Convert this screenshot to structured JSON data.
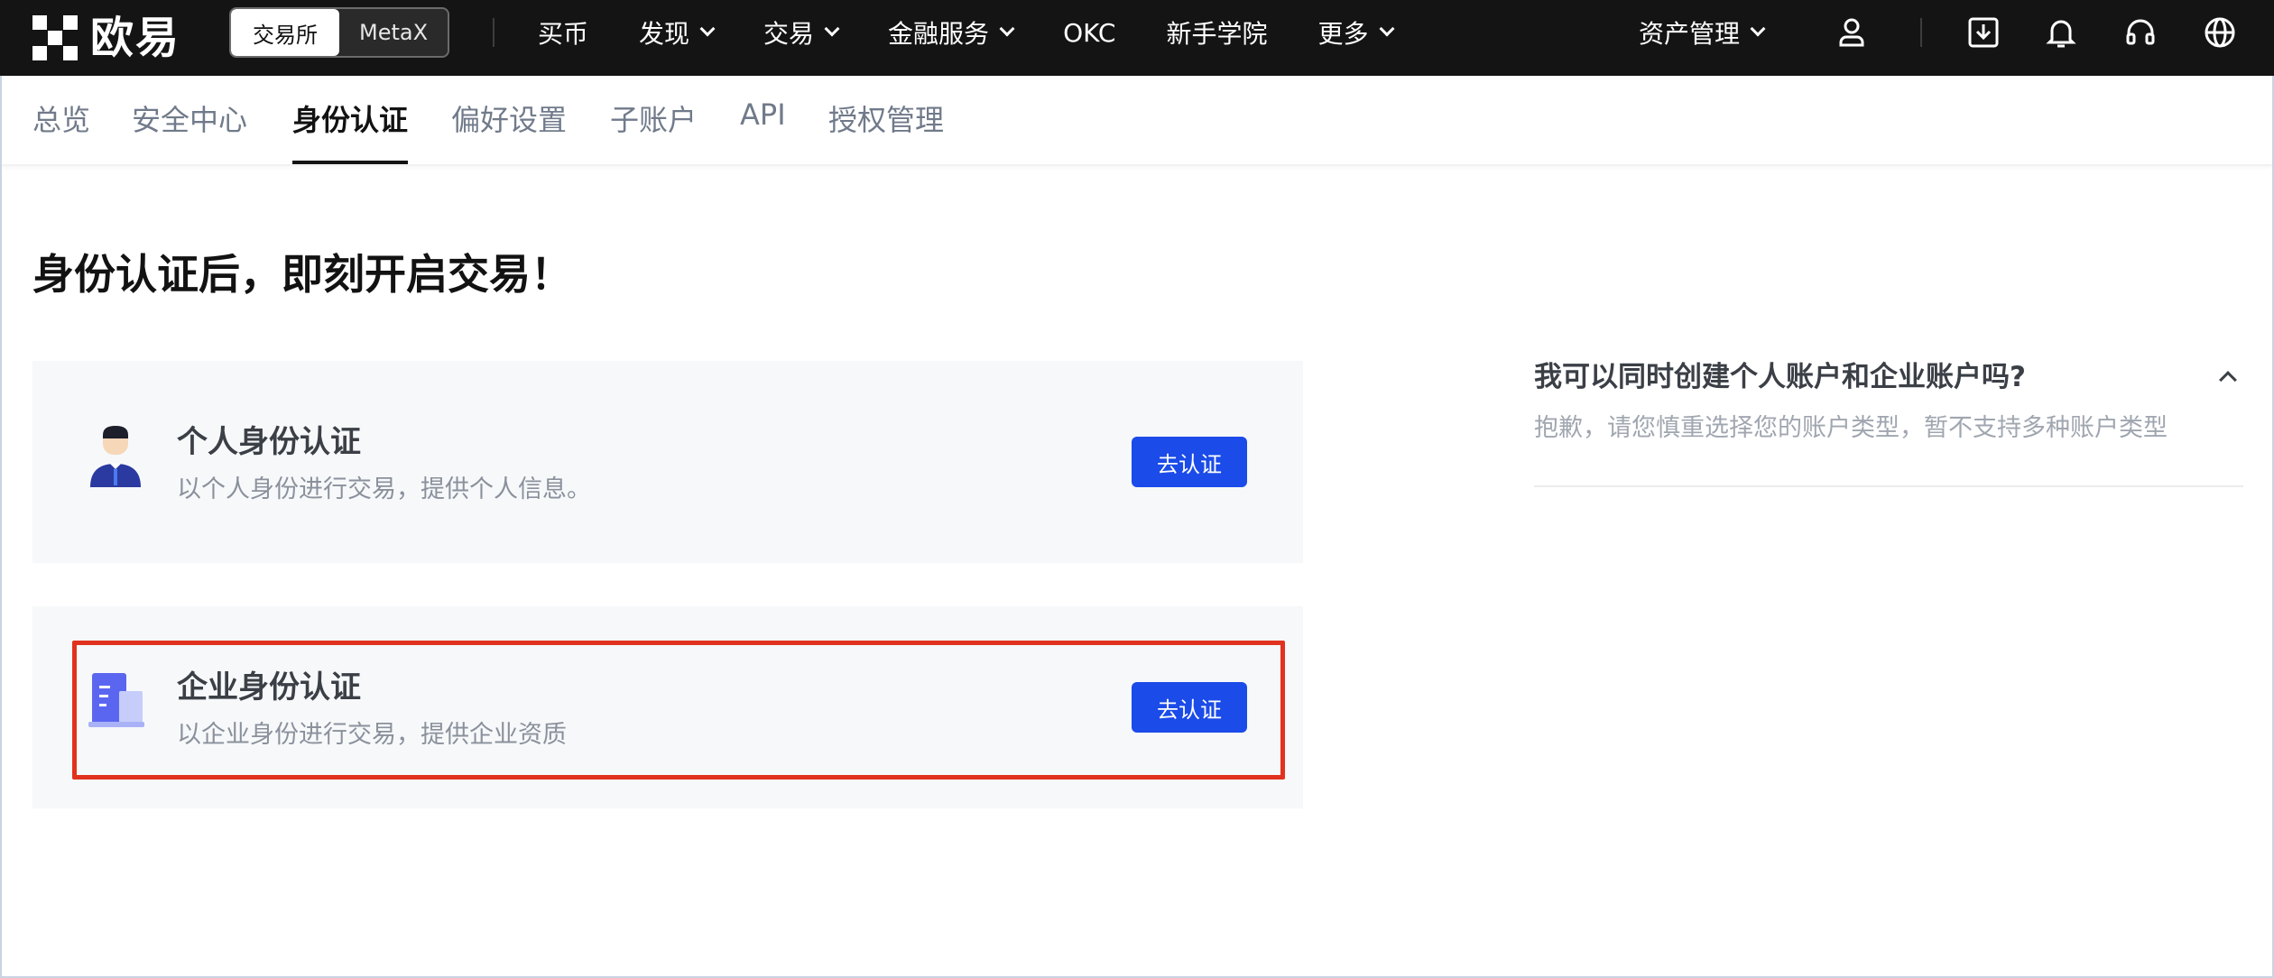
{
  "header": {
    "logo_text": "欧易",
    "switch": [
      "交易所",
      "MetaX"
    ],
    "nav": [
      {
        "label": "买币",
        "dropdown": false
      },
      {
        "label": "发现",
        "dropdown": true
      },
      {
        "label": "交易",
        "dropdown": true
      },
      {
        "label": "金融服务",
        "dropdown": true
      },
      {
        "label": "OKC",
        "dropdown": false
      },
      {
        "label": "新手学院",
        "dropdown": false
      },
      {
        "label": "更多",
        "dropdown": true
      }
    ],
    "assets_label": "资产管理",
    "icons": [
      "user-icon",
      "download-icon",
      "bell-icon",
      "headset-icon",
      "globe-icon"
    ]
  },
  "subnav": {
    "items": [
      "总览",
      "安全中心",
      "身份认证",
      "偏好设置",
      "子账户",
      "API",
      "授权管理"
    ],
    "active": "身份认证"
  },
  "main": {
    "title": "身份认证后，即刻开启交易！",
    "cards": [
      {
        "title": "个人身份认证",
        "desc": "以个人身份进行交易，提供个人信息。",
        "button": "去认证",
        "icon": "person-icon"
      },
      {
        "title": "企业身份认证",
        "desc": "以企业身份进行交易，提供企业资质",
        "button": "去认证",
        "icon": "building-icon"
      }
    ]
  },
  "faq": {
    "question": "我可以同时创建个人账户和企业账户吗?",
    "answer": "抱歉，请您慎重选择您的账户类型，暂不支持多种账户类型"
  },
  "colors": {
    "header_bg": "#141414",
    "primary_button": "#1b4be8",
    "card_bg": "#f7f8fa",
    "highlight": "#e0321e"
  }
}
